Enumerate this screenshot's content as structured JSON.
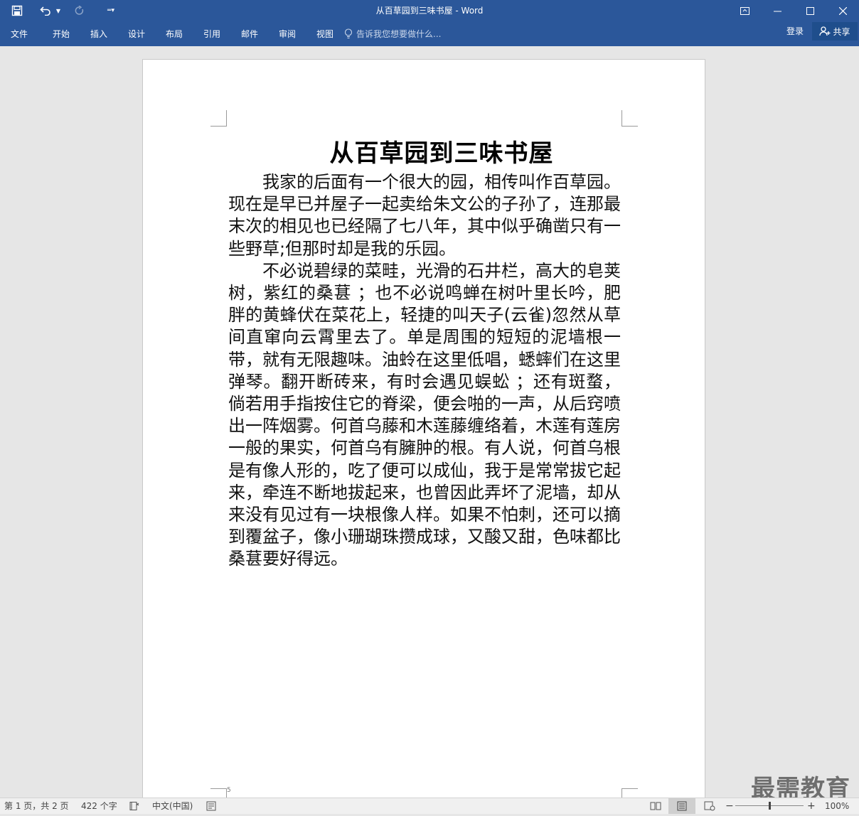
{
  "window": {
    "title": "从百草园到三味书屋 - Word"
  },
  "ribbon": {
    "tabs": [
      "文件",
      "开始",
      "插入",
      "设计",
      "布局",
      "引用",
      "邮件",
      "审阅",
      "视图"
    ],
    "tell_me_placeholder": "告诉我您想要做什么...",
    "login_label": "登录",
    "share_label": "共享"
  },
  "document": {
    "title": "从百草园到三味书屋",
    "paragraphs": [
      "我家的后面有一个很大的园，相传叫作百草园。现在是早已并屋子一起卖给朱文公的子孙了，连那最末次的相见也已经隔了七八年，其中似乎确凿只有一些野草;但那时却是我的乐园。",
      "不必说碧绿的菜畦，光滑的石井栏，高大的皂荚树，紫红的桑葚 ；也不必说鸣蝉在树叶里长吟，肥胖的黄蜂伏在菜花上，轻捷的叫天子(云雀)忽然从草间直窜向云霄里去了。单是周围的短短的泥墙根一带，就有无限趣味。油蛉在这里低唱，蟋蟀们在这里弹琴。翻开断砖来，有时会遇见蜈蚣 ；还有斑蝥，倘若用手指按住它的脊梁，便会啪的一声，从后窍喷出一阵烟雾。何首乌藤和木莲藤缠络着，木莲有莲房一般的果实，何首乌有臃肿的根。有人说，何首乌根是有像人形的，吃了便可以成仙，我于是常常拔它起来，牵连不断地拔起来，也曾因此弄坏了泥墙，却从来没有见过有一块根像人样。如果不怕刺，还可以摘到覆盆子，像小珊瑚珠攒成球，又酸又甜，色味都比桑葚要好得远。"
    ],
    "page_marker": "5"
  },
  "status": {
    "page_info": "第 1 页，共 2 页",
    "word_count": "422 个字",
    "language": "中文(中国)",
    "zoom": "100%",
    "zoom_level": 0.5
  },
  "watermark": "最需教育",
  "colors": {
    "ribbon": "#2b579a",
    "page": "#ffffff",
    "canvas": "#e6e6e6"
  }
}
